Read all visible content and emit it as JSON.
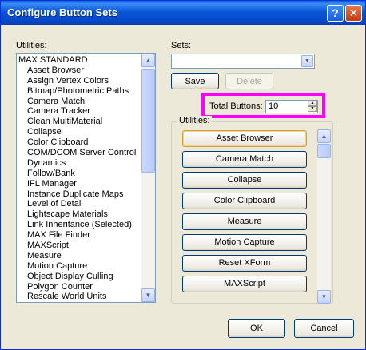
{
  "window": {
    "title": "Configure Button Sets",
    "help_glyph": "?",
    "close_glyph": "✕"
  },
  "utilities_list": {
    "label": "Utilities:",
    "items": [
      "MAX STANDARD",
      "Asset Browser",
      "Assign Vertex Colors",
      "Bitmap/Photometric Paths",
      "Camera Match",
      "Camera Tracker",
      "Clean MultiMaterial",
      "Collapse",
      "Color Clipboard",
      "COM/DCOM Server Control",
      "Dynamics",
      "Follow/Bank",
      "IFL Manager",
      "Instance Duplicate Maps",
      "Level of Detail",
      "Lightscape Materials",
      "Link Inheritance (Selected)",
      "MAX File Finder",
      "MAXScript",
      "Measure",
      "Motion Capture",
      "Object Display Culling",
      "Polygon Counter",
      "Rescale World Units"
    ]
  },
  "sets": {
    "label": "Sets:",
    "value": "",
    "save_label": "Save",
    "delete_label": "Delete"
  },
  "total_buttons": {
    "label": "Total Buttons:",
    "value": "10"
  },
  "set_utilities": {
    "label": "Utilities:",
    "buttons": [
      "Asset Browser",
      "Camera Match",
      "Collapse",
      "Color Clipboard",
      "Measure",
      "Motion Capture",
      "Reset XForm",
      "MAXScript"
    ]
  },
  "footer": {
    "ok_label": "OK",
    "cancel_label": "Cancel"
  },
  "colors": {
    "title_bar": "#0a56d8",
    "highlight": "#ff00ff",
    "dialog_bg": "#ece9d8"
  }
}
